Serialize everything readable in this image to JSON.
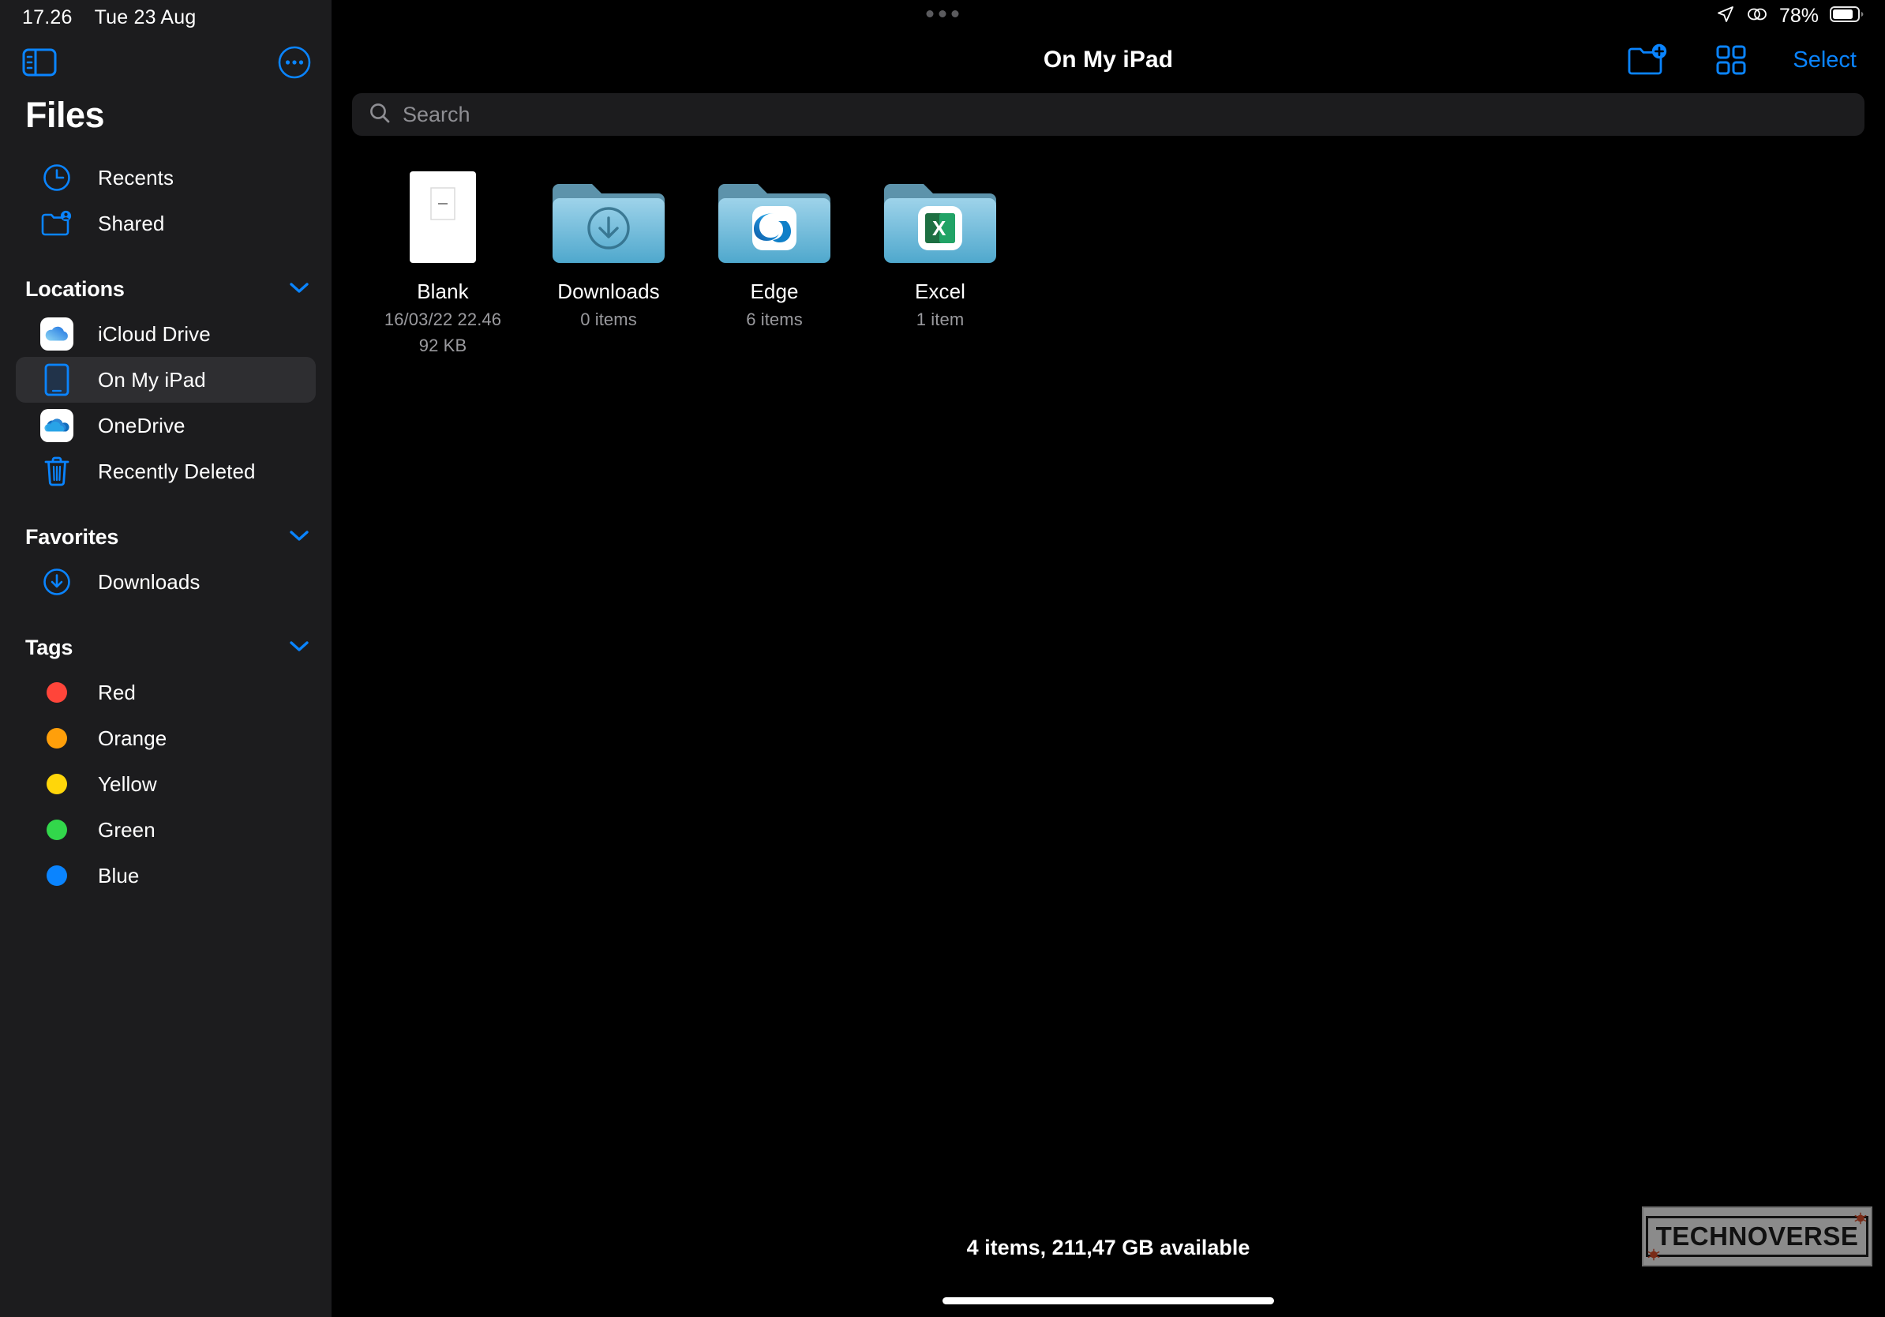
{
  "statusbar": {
    "time": "17.26",
    "date": "Tue 23 Aug",
    "battery_pct": "78%",
    "location_icon": "location-arrow-icon",
    "mirroring_icon": "screen-mirroring-icon",
    "battery_icon": "battery-icon"
  },
  "sidebar": {
    "app_title": "Files",
    "toggle_icon": "sidebar-toggle-icon",
    "more_icon": "more-circle-icon",
    "quick": [
      {
        "label": "Recents",
        "icon": "clock-icon"
      },
      {
        "label": "Shared",
        "icon": "shared-folder-icon"
      }
    ],
    "sections": [
      {
        "title": "Locations",
        "chevron": "chevron-down-icon",
        "items": [
          {
            "label": "iCloud Drive",
            "icon": "icloud-drive-icon",
            "selected": false
          },
          {
            "label": "On My iPad",
            "icon": "ipad-icon",
            "selected": true
          },
          {
            "label": "OneDrive",
            "icon": "onedrive-icon",
            "selected": false
          },
          {
            "label": "Recently Deleted",
            "icon": "trash-icon",
            "selected": false
          }
        ]
      },
      {
        "title": "Favorites",
        "chevron": "chevron-down-icon",
        "items": [
          {
            "label": "Downloads",
            "icon": "download-circle-icon",
            "selected": false
          }
        ]
      },
      {
        "title": "Tags",
        "chevron": "chevron-down-icon",
        "items": [
          {
            "label": "Red",
            "icon": "tag-dot-icon",
            "color": "#FF453A"
          },
          {
            "label": "Orange",
            "icon": "tag-dot-icon",
            "color": "#FF9F0A"
          },
          {
            "label": "Yellow",
            "icon": "tag-dot-icon",
            "color": "#FFD60A"
          },
          {
            "label": "Green",
            "icon": "tag-dot-icon",
            "color": "#32D74B"
          },
          {
            "label": "Blue",
            "icon": "tag-dot-icon",
            "color": "#0A84FF"
          }
        ]
      }
    ]
  },
  "main": {
    "title": "On My iPad",
    "actions": {
      "new_folder_icon": "new-folder-icon",
      "view_grid_icon": "grid-view-icon",
      "select_label": "Select"
    },
    "search": {
      "placeholder": "Search",
      "value": "",
      "icon": "search-icon"
    },
    "items": [
      {
        "name": "Blank",
        "meta1": "16/03/22 22.46",
        "meta2": "92 KB",
        "kind": "document"
      },
      {
        "name": "Downloads",
        "meta1": "0 items",
        "meta2": "",
        "kind": "folder-download"
      },
      {
        "name": "Edge",
        "meta1": "6 items",
        "meta2": "",
        "kind": "folder-edge"
      },
      {
        "name": "Excel",
        "meta1": "1 item",
        "meta2": "",
        "kind": "folder-excel"
      }
    ],
    "footer": "4 items, 211,47 GB available"
  },
  "watermark": {
    "text": "TECHNOVERSE"
  },
  "colors": {
    "accent": "#0A84FF",
    "sidebar_bg": "#1C1C1E",
    "content_bg": "#000000"
  }
}
